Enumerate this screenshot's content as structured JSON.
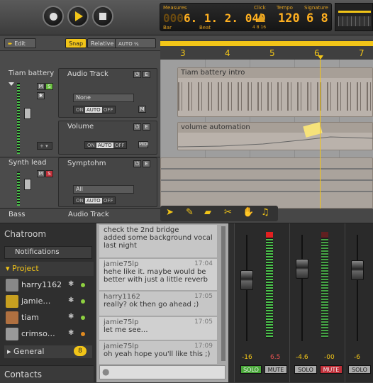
{
  "lcd": {
    "measures_label": "Measures",
    "bar_label": "Bar",
    "beat_label": "Beat",
    "position": "6. 1. 2. 040",
    "position_dim": "000",
    "click_label": "Click",
    "click_beats": "4  8  16",
    "tempo_label": "Tempo",
    "tempo": "120",
    "signature_label": "Signature",
    "signature": "6 8"
  },
  "toolbar": {
    "edit": "Edit",
    "snap": "Snap",
    "relative": "Relative",
    "auto_label": "AUTO ¼"
  },
  "ruler": {
    "bars": [
      "3",
      "4",
      "5",
      "6",
      "7"
    ]
  },
  "tracks": [
    {
      "name": "Tiam battery",
      "plugin": "Audio Track",
      "input": "None",
      "clip": "Tiam battery intro"
    },
    {
      "name": "",
      "plugin": "Volume",
      "clip": "volume automation"
    },
    {
      "name": "Synth lead",
      "plugin": "Symptohm",
      "input": "All"
    },
    {
      "name": "Bass",
      "plugin": "Audio Track"
    }
  ],
  "auto": {
    "on": "ON",
    "auto": "AUTO",
    "off": "OFF",
    "m": "M",
    "midi": "MIDI"
  },
  "chat": {
    "chatroom": "Chatroom",
    "notifications": "Notifications",
    "project": "Project",
    "users": [
      {
        "name": "harry1162",
        "status": "#8ed040"
      },
      {
        "name": "jamie…",
        "status": "#8ed040"
      },
      {
        "name": "tiam",
        "status": "#8ed040"
      },
      {
        "name": "crimso…",
        "status": "#e08a20"
      }
    ],
    "general": "General",
    "general_count": "8",
    "contacts": "Contacts",
    "messages": [
      {
        "text": "check the 2nd bridge"
      },
      {
        "text": "added some background vocal last night"
      },
      {
        "author": "jamie75lp",
        "time": "17:04",
        "text": "hehe like it. maybe would be better with just a little reverb"
      },
      {
        "author": "harry1162",
        "time": "17:05",
        "text": "really? ok then go ahead ;)"
      },
      {
        "author": "jamie75lp",
        "time": "17:05",
        "text": "let me see…"
      },
      {
        "author": "jamie75lp",
        "time": "17:09",
        "text": "oh yeah hope you'll like this ;)"
      }
    ]
  },
  "mixer": {
    "strips": [
      {
        "l": "-16",
        "r": "6.5",
        "solo": "SOLO",
        "mute": "MUTE"
      },
      {
        "l": "-4.6",
        "r": "-00",
        "solo": "SOLO",
        "mute": "MUTE"
      },
      {
        "l": "-6",
        "solo": "SOLO"
      }
    ]
  },
  "colors": {
    "accent": "#f2c518",
    "solo_on": "#4aa83a",
    "mute_on": "#c0303a"
  }
}
